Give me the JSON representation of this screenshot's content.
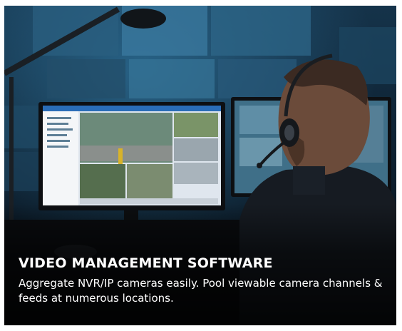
{
  "card": {
    "heading": "VIDEO MANAGEMENT SOFTWARE",
    "description": "Aggregate NVR/IP cameras easily. Pool viewable camera channels & feeds at numerous locations."
  },
  "colors": {
    "overlay_text": "#ffffff",
    "scene_background": "#0b1824",
    "screen_glow": "#3a8fc0"
  },
  "icons": [
    "desk-lamp-icon",
    "headset-icon",
    "monitor-icon"
  ]
}
